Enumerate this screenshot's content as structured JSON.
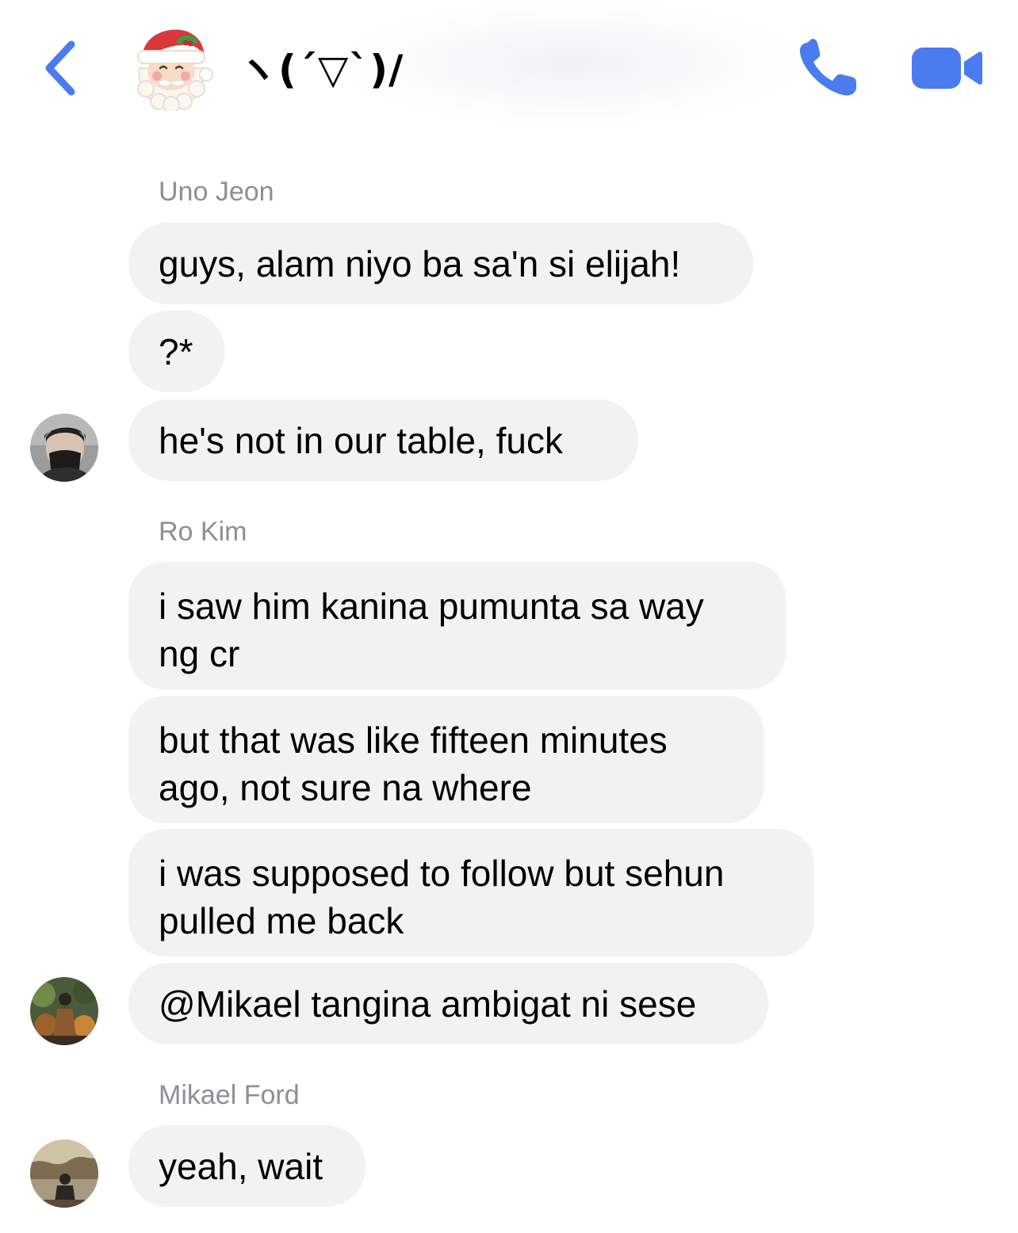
{
  "header": {
    "title": "ヽ(´▽`)/",
    "colors": {
      "accent": "#4a7cf0"
    },
    "icons": [
      "back-chevron-icon",
      "santa-icon",
      "phone-icon",
      "video-camera-icon"
    ]
  },
  "messages": {
    "g1": {
      "sender": "Uno Jeon",
      "m1": "guys, alam niyo ba sa'n si elijah!",
      "m2": "?*",
      "m3": "he's not in our table, fuck"
    },
    "g2": {
      "sender": "Ro Kim",
      "m1a": "i saw him kanina pumunta sa way",
      "m1b": "ng cr",
      "m2a": "but that was like fifteen minutes",
      "m2b": "ago, not sure na where",
      "m3a": "i was supposed to follow but sehun",
      "m3b": "pulled me back",
      "m4": "@Mikael tangina ambigat ni sese"
    },
    "g3": {
      "sender": "Mikael Ford",
      "m1": "yeah, wait"
    }
  }
}
